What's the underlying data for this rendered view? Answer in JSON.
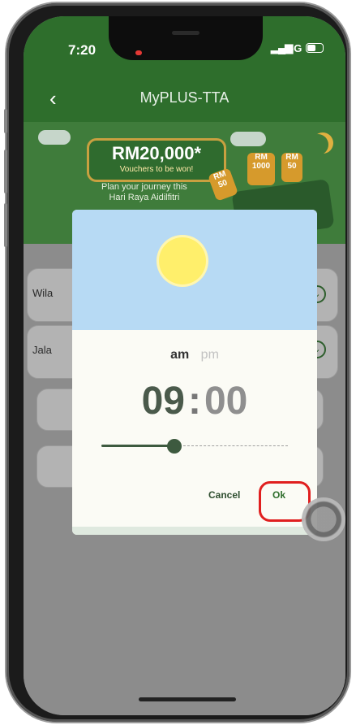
{
  "status_bar": {
    "time": "7:20",
    "network": "5G"
  },
  "header": {
    "title": "MyPLUS-TTA"
  },
  "banner": {
    "amount": "RM20,000*",
    "vouchers_line": "Vouchers to be won!",
    "journey_line1": "Plan your journey this",
    "journey_line2": "Hari Raya Aidilfitri",
    "gift_1": "RM 50",
    "gift_2": "RM 1000",
    "gift_3": "RM 50"
  },
  "form": {
    "field_1_label": "Wila",
    "field_2_label": "Jala"
  },
  "time_dialog": {
    "am_label": "am",
    "pm_label": "pm",
    "hour": "09",
    "separator": ":",
    "minute": "00",
    "slider_value_fraction": 0.39,
    "cancel_label": "Cancel",
    "ok_label": "Ok"
  },
  "colors": {
    "brand_green": "#2e6e2c",
    "highlight_red": "#e01f1f"
  }
}
